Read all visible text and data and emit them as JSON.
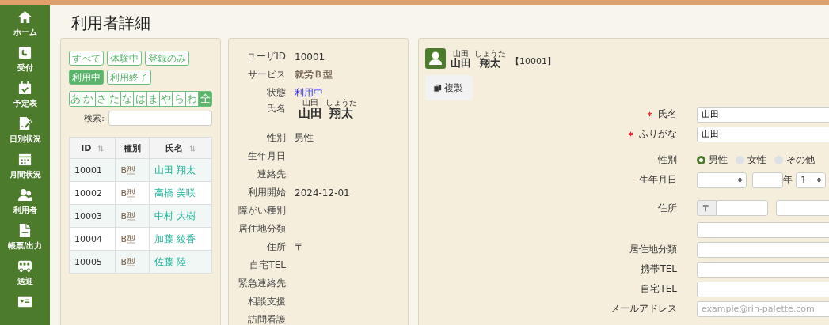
{
  "sidebar": {
    "items": [
      {
        "kind": "labeled",
        "label": "ホーム"
      },
      {
        "kind": "labeled",
        "label": "受付"
      },
      {
        "kind": "labeled",
        "label": "予定表"
      },
      {
        "kind": "labeled",
        "label": "日別状況"
      },
      {
        "kind": "labeled",
        "label": "月間状況"
      },
      {
        "kind": "labeled",
        "label": "利用者"
      },
      {
        "kind": "labeled",
        "label": "帳票/出力"
      },
      {
        "kind": "labeled",
        "label": "送迎"
      },
      {
        "kind": "icon_only"
      }
    ]
  },
  "page_title": "利用者詳細",
  "list_panel": {
    "filters": [
      {
        "label": "すべて",
        "selected": false
      },
      {
        "label": "体験中",
        "selected": false
      },
      {
        "label": "登録のみ",
        "selected": false
      },
      {
        "label": "利用中",
        "selected": true
      },
      {
        "label": "利用終了",
        "selected": false
      }
    ],
    "kana": [
      {
        "label": "あ",
        "selected": false
      },
      {
        "label": "か",
        "selected": false
      },
      {
        "label": "さ",
        "selected": false
      },
      {
        "label": "た",
        "selected": false
      },
      {
        "label": "な",
        "selected": false
      },
      {
        "label": "は",
        "selected": false
      },
      {
        "label": "ま",
        "selected": false
      },
      {
        "label": "や",
        "selected": false
      },
      {
        "label": "ら",
        "selected": false
      },
      {
        "label": "わ",
        "selected": false
      },
      {
        "label": "全",
        "selected": true
      }
    ],
    "search_label": "検索:",
    "table": {
      "columns": [
        {
          "label": "ID",
          "sortable": true
        },
        {
          "label": "種別",
          "sortable": false
        },
        {
          "label": "氏名",
          "sortable": true
        }
      ],
      "rows": [
        [
          "10001",
          "B型",
          "山田 翔太"
        ],
        [
          "10002",
          "B型",
          "高橋 美咲"
        ],
        [
          "10003",
          "B型",
          "中村 大樹"
        ],
        [
          "10004",
          "B型",
          "加藤 綾香"
        ],
        [
          "10005",
          "B型",
          "佐藤 陸"
        ]
      ]
    }
  },
  "detail_panel": {
    "rows": [
      {
        "label": "ユーザID",
        "kind": "text",
        "value": "10001"
      },
      {
        "label": "サービス",
        "kind": "bold",
        "value": "就労Ｂ型"
      },
      {
        "label": "状態",
        "kind": "status",
        "value": "利用中"
      },
      {
        "label": "氏名",
        "kind": "name",
        "family": "山田",
        "family_ruby": "山田",
        "given": "翔太",
        "given_ruby": "しょうた"
      },
      {
        "label": "性別",
        "kind": "text",
        "value": "男性"
      },
      {
        "label": "生年月日",
        "kind": "text"
      },
      {
        "label": "連絡先",
        "kind": "text"
      },
      {
        "label": "利用開始",
        "kind": "text",
        "value": "2024-12-01"
      },
      {
        "label": "障がい種別",
        "kind": "text"
      },
      {
        "label": "居住地分類",
        "kind": "text"
      },
      {
        "label": "住所",
        "kind": "text",
        "value": "〒"
      },
      {
        "label": "自宅TEL",
        "kind": "text"
      },
      {
        "label": "緊急連絡先",
        "kind": "text"
      },
      {
        "label": "相談支援",
        "kind": "text"
      },
      {
        "label": "訪問看護",
        "kind": "text"
      }
    ]
  },
  "edit_panel": {
    "header": {
      "family": "山田",
      "family_ruby": "山田",
      "given": "翔太",
      "given_ruby": "しょうた",
      "id": "【10001】"
    },
    "copy_button": "複製",
    "rows": [
      {
        "kind": "text",
        "label": "氏名",
        "required": true,
        "value": "山田"
      },
      {
        "kind": "text",
        "label": "ふりがな",
        "required": true,
        "value": "山田"
      },
      {
        "kind": "radio",
        "label": "性別",
        "options": [
          {
            "label": "男性",
            "selected": true
          },
          {
            "label": "女性",
            "selected": false
          },
          {
            "label": "その他",
            "selected": false
          }
        ]
      },
      {
        "kind": "date",
        "label": "生年月日",
        "year_unit": "年",
        "month": "1"
      },
      {
        "kind": "address",
        "label": "住所",
        "postal_mark": "〒"
      },
      {
        "kind": "text"
      },
      {
        "kind": "text",
        "label": "居住地分類"
      },
      {
        "kind": "text",
        "label": "携帯TEL"
      },
      {
        "kind": "text",
        "label": "自宅TEL"
      },
      {
        "kind": "text",
        "label": "メールアドレス",
        "placeholder": "example@rin-palette.com"
      }
    ]
  }
}
